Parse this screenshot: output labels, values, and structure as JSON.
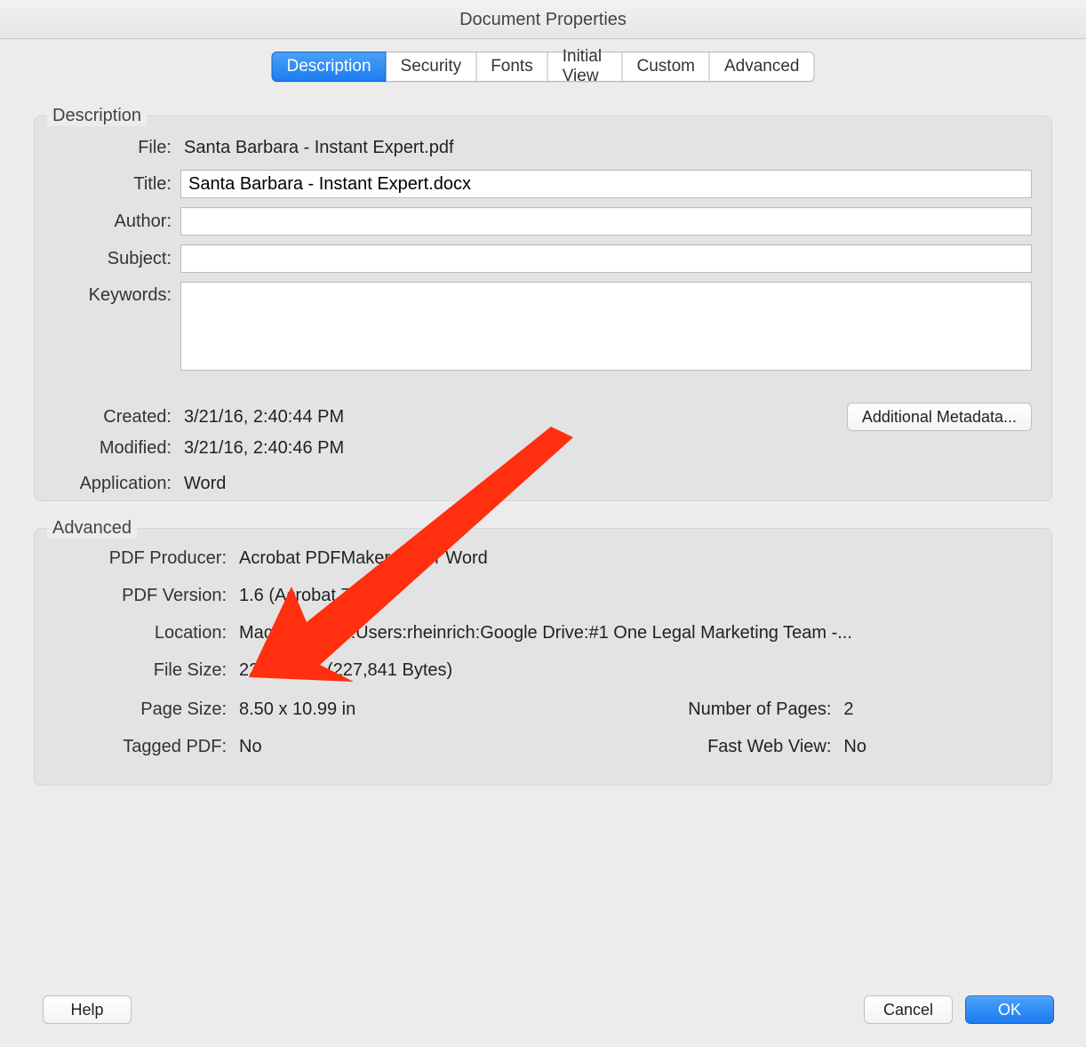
{
  "window_title": "Document Properties",
  "tabs": [
    "Description",
    "Security",
    "Fonts",
    "Initial View",
    "Custom",
    "Advanced"
  ],
  "active_tab_index": 0,
  "description": {
    "legend": "Description",
    "file_label": "File:",
    "file_value": "Santa Barbara - Instant Expert.pdf",
    "title_label": "Title:",
    "title_value": "Santa Barbara - Instant Expert.docx",
    "author_label": "Author:",
    "author_value": "",
    "subject_label": "Subject:",
    "subject_value": "",
    "keywords_label": "Keywords:",
    "keywords_value": "",
    "created_label": "Created:",
    "created_value": "3/21/16, 2:40:44 PM",
    "modified_label": "Modified:",
    "modified_value": "3/21/16, 2:40:46 PM",
    "application_label": "Application:",
    "application_value": "Word",
    "additional_metadata_label": "Additional Metadata..."
  },
  "advanced": {
    "legend": "Advanced",
    "producer_label": "PDF Producer:",
    "producer_value": "Acrobat PDFMaker 15 for Word",
    "version_label": "PDF Version:",
    "version_value": "1.6 (Acrobat 7.x)",
    "location_label": "Location:",
    "location_value": "Macintosh HD:Users:rheinrich:Google Drive:#1 One Legal Marketing Team -...",
    "filesize_label": "File Size:",
    "filesize_value": "222.50 KB (227,841 Bytes)",
    "pagesize_label": "Page Size:",
    "pagesize_value": "8.50 x 10.99 in",
    "numpages_label": "Number of Pages:",
    "numpages_value": "2",
    "tagged_label": "Tagged PDF:",
    "tagged_value": "No",
    "fastweb_label": "Fast Web View:",
    "fastweb_value": "No"
  },
  "buttons": {
    "help": "Help",
    "cancel": "Cancel",
    "ok": "OK"
  },
  "annotation": {
    "type": "arrow",
    "color": "#ff2600"
  }
}
